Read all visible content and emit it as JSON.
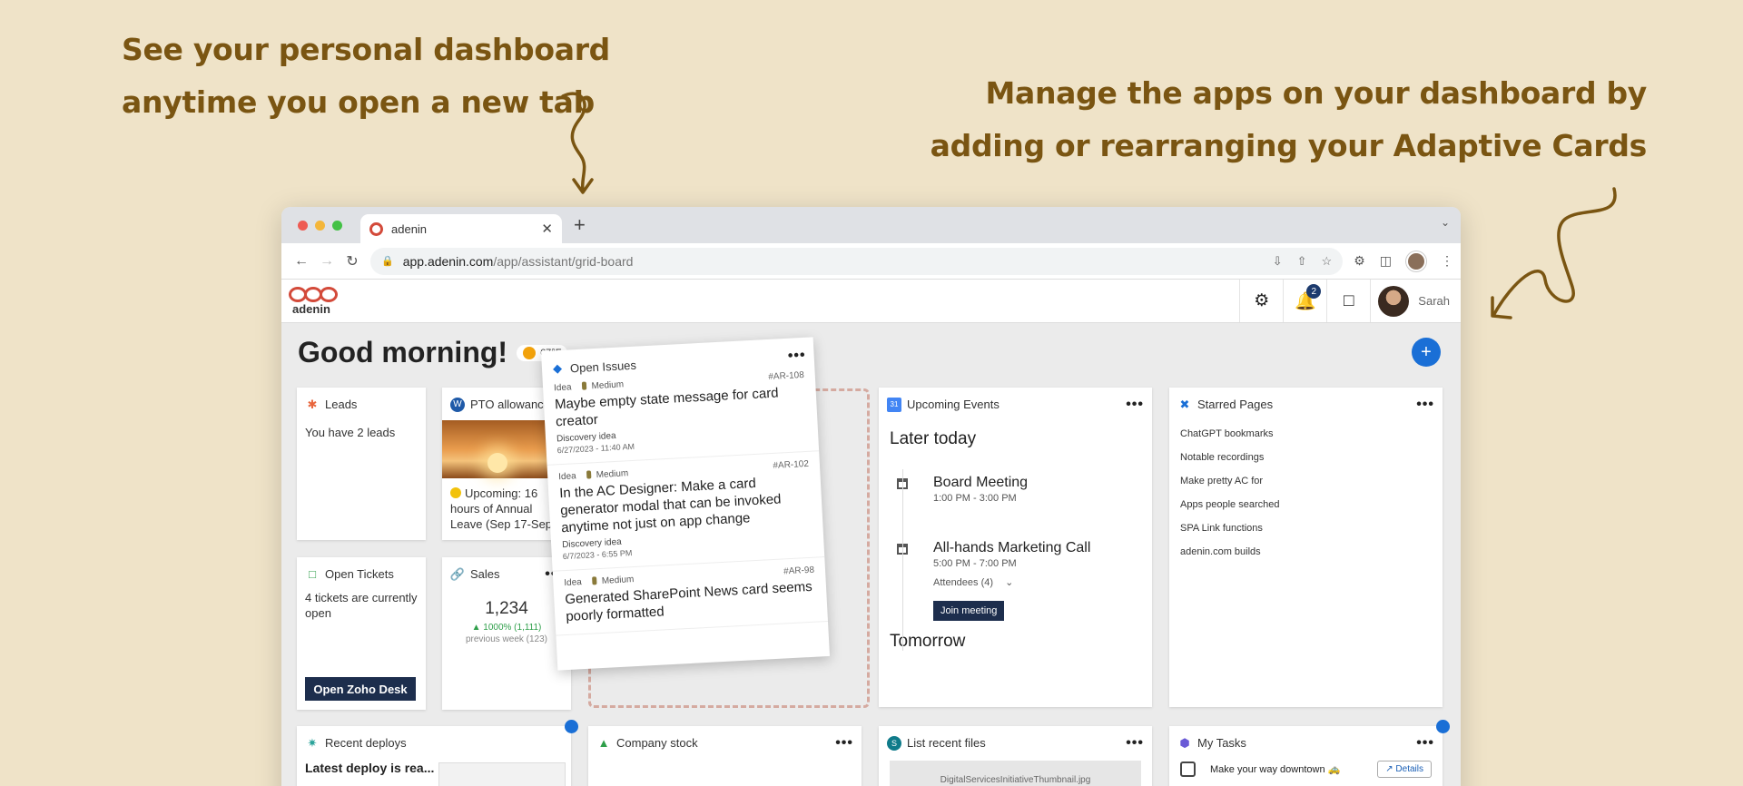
{
  "promo": {
    "left_line1": "See your personal dashboard",
    "left_line2": "anytime you open a new tab",
    "right_line1": "Manage the apps on your dashboard by",
    "right_line2": "adding or rearranging your Adaptive Cards"
  },
  "browser": {
    "tab_title": "adenin",
    "tab_close": "✕",
    "new_tab": "+",
    "url_domain": "app.adenin.com",
    "url_path": "/app/assistant/grid-board"
  },
  "app": {
    "logo_text": "adenin",
    "notification_count": "2",
    "user_name": "Sarah"
  },
  "board": {
    "greeting": "Good morning!",
    "temperature": "67°F",
    "fab_label": "+"
  },
  "cards": {
    "leads": {
      "title": "Leads",
      "body": "You have 2 leads"
    },
    "pto": {
      "title": "PTO allowance",
      "body": "Upcoming: 16 hours of Annual Leave (Sep 17-Sep"
    },
    "tickets": {
      "title": "Open Tickets",
      "body": "4 tickets are currently open",
      "button": "Open Zoho Desk"
    },
    "sales": {
      "title": "Sales",
      "value": "1,234",
      "change": "▲ 1000% (1,111)",
      "previous": "previous week (123)"
    },
    "issues": {
      "title": "Open Issues",
      "items": [
        {
          "type": "Idea",
          "priority": "Medium",
          "id": "#AR-108",
          "title": "Maybe empty state message for card creator",
          "sub": "Discovery idea",
          "date": "6/27/2023 - 11:40 AM"
        },
        {
          "type": "Idea",
          "priority": "Medium",
          "id": "#AR-102",
          "title": "In the AC Designer: Make a card generator modal that can be invoked anytime not just on app change",
          "sub": "Discovery idea",
          "date": "6/7/2023 - 6:55 PM"
        },
        {
          "type": "Idea",
          "priority": "Medium",
          "id": "#AR-98",
          "title": "Generated SharePoint News card seems poorly formatted",
          "sub": "",
          "date": ""
        }
      ]
    },
    "events": {
      "title": "Upcoming Events",
      "later": "Later today",
      "e1_title": "Board Meeting",
      "e1_time": "1:00 PM - 3:00 PM",
      "e2_title": "All-hands Marketing Call",
      "e2_time": "5:00 PM - 7:00 PM",
      "e2_attendees": "Attendees (4)",
      "join": "Join meeting",
      "tomorrow": "Tomorrow"
    },
    "starred": {
      "title": "Starred Pages",
      "items": [
        "ChatGPT bookmarks",
        "Notable recordings",
        "Make pretty AC for",
        "Apps people searched",
        "SPA Link functions",
        "adenin.com builds"
      ]
    },
    "deploys": {
      "title": "Recent deploys",
      "body": "Latest deploy is rea..."
    },
    "stock": {
      "title": "Company stock"
    },
    "files": {
      "title": "List recent files",
      "file": "DigitalServicesInitiativeThumbnail.jpg"
    },
    "tasks": {
      "title": "My Tasks",
      "task": "Make your way downtown 🚕",
      "details": "Details"
    }
  },
  "icons": {
    "more": "•••",
    "calendar_date": "31"
  },
  "colors": {
    "background": "#efe3c8",
    "promo_text": "#7a5512",
    "accent_blue": "#1a6fd6",
    "navy_button": "#1d2e4d",
    "adenin_red": "#d34a3a"
  }
}
